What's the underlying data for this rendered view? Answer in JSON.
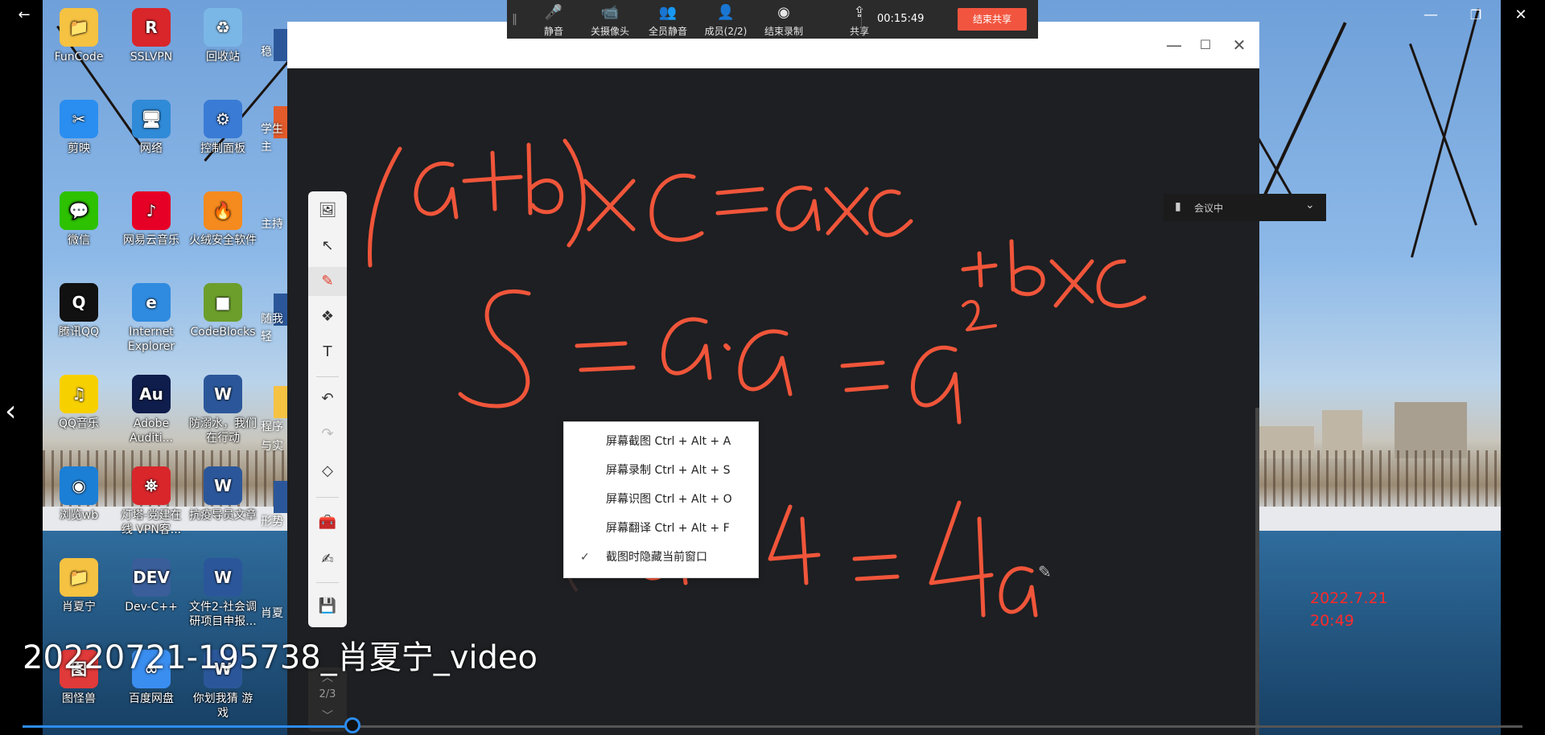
{
  "video": {
    "title": "20220721-195738_肖夏宁_video",
    "progress_percent": 22,
    "date_line1": "2022.7.21",
    "date_line2": "20:49"
  },
  "desktop_icons": [
    {
      "label": "FunCode",
      "color": "#f5c242",
      "glyph": "📁"
    },
    {
      "label": "SSLVPN",
      "color": "#d8262b",
      "glyph": "R"
    },
    {
      "label": "回收站",
      "color": "#7bb7e6",
      "glyph": "♻"
    },
    {
      "label": "剪映",
      "color": "#2a8ef0",
      "glyph": "✂"
    },
    {
      "label": "网络",
      "color": "#2f8ad7",
      "glyph": "🖥"
    },
    {
      "label": "控制面板",
      "color": "#3a7bd5",
      "glyph": "⚙"
    },
    {
      "label": "微信",
      "color": "#2dc100",
      "glyph": "💬"
    },
    {
      "label": "网易云音乐",
      "color": "#e60026",
      "glyph": "♪"
    },
    {
      "label": "火绒安全软件",
      "color": "#f58a1f",
      "glyph": "🔥"
    },
    {
      "label": "腾讯QQ",
      "color": "#111111",
      "glyph": "Q"
    },
    {
      "label": "Internet Explorer",
      "color": "#2f8be0",
      "glyph": "e"
    },
    {
      "label": "CodeBlocks",
      "color": "#6c9e2c",
      "glyph": "■"
    },
    {
      "label": "QQ音乐",
      "color": "#f7d000",
      "glyph": "♫"
    },
    {
      "label": "Adobe Auditi...",
      "color": "#0f1d4d",
      "glyph": "Au"
    },
    {
      "label": "防溺水，我们在行动",
      "color": "#2b579a",
      "glyph": "W"
    },
    {
      "label": "浏览wb",
      "color": "#1b7fd6",
      "glyph": "◉"
    },
    {
      "label": "灯塔-党建在线 VPN客...",
      "color": "#d8262b",
      "glyph": "⛯"
    },
    {
      "label": "抗疫导员文章",
      "color": "#2b579a",
      "glyph": "W"
    },
    {
      "label": "肖夏宁",
      "color": "#f5c242",
      "glyph": "📁"
    },
    {
      "label": "Dev-C++",
      "color": "#3a5e9a",
      "glyph": "DEV"
    },
    {
      "label": "文件2-社会调研项目申报...",
      "color": "#2b579a",
      "glyph": "W"
    },
    {
      "label": "图怪兽",
      "color": "#e03a3a",
      "glyph": "图"
    },
    {
      "label": "百度网盘",
      "color": "#3a8ef0",
      "glyph": "∞"
    },
    {
      "label": "你划我猜 游戏",
      "color": "#2b579a",
      "glyph": "W"
    }
  ],
  "desktop_partial_labels": [
    "稳",
    "学生",
    "主",
    "主持",
    "随我",
    "轻",
    "程序",
    "与实",
    "形势",
    "肖夏"
  ],
  "meeting_toolbar": {
    "items": [
      {
        "label": "静音",
        "icon": "microphone-icon",
        "glyph": "🎤"
      },
      {
        "label": "关摄像头",
        "icon": "camera-icon",
        "glyph": "📹"
      },
      {
        "label": "全员静音",
        "icon": "mute-all-icon",
        "glyph": "👥"
      },
      {
        "label": "成员(2/2)",
        "icon": "members-icon",
        "glyph": "👤"
      },
      {
        "label": "结束录制",
        "icon": "record-icon",
        "glyph": "◉"
      },
      {
        "label": "共享",
        "icon": "share-icon",
        "glyph": "⇪"
      }
    ],
    "timer": "00:15:49",
    "end_share": "结束共享"
  },
  "whiteboard": {
    "page_indicator": "2/3",
    "tools": [
      {
        "name": "image-icon",
        "glyph": "🖼"
      },
      {
        "name": "select-icon",
        "glyph": "↖"
      },
      {
        "name": "pen-icon",
        "glyph": "✎"
      },
      {
        "name": "shapes-icon",
        "glyph": "❖"
      },
      {
        "name": "text-icon",
        "glyph": "T"
      },
      {
        "name": "undo-icon",
        "glyph": "↶"
      },
      {
        "name": "redo-icon",
        "glyph": "↷"
      },
      {
        "name": "eraser-icon",
        "glyph": "◇"
      },
      {
        "name": "toolbox-icon",
        "glyph": "🧰"
      },
      {
        "name": "edit-icon",
        "glyph": "✍"
      },
      {
        "name": "save-icon",
        "glyph": "💾"
      }
    ]
  },
  "context_menu": {
    "items": [
      {
        "label": "屏幕截图 Ctrl + Alt + A",
        "checked": false
      },
      {
        "label": "屏幕录制 Ctrl + Alt + S",
        "checked": false
      },
      {
        "label": "屏幕识图 Ctrl + Alt + O",
        "checked": false
      },
      {
        "label": "屏幕翻译 Ctrl + Alt + F",
        "checked": false
      },
      {
        "label": "截图时隐藏当前窗口",
        "checked": true
      }
    ]
  },
  "meeting_status": {
    "label": "会议中"
  },
  "colors": {
    "ink": "#f0553a",
    "accent": "#2d8cf0",
    "end_share": "#f2553f"
  }
}
